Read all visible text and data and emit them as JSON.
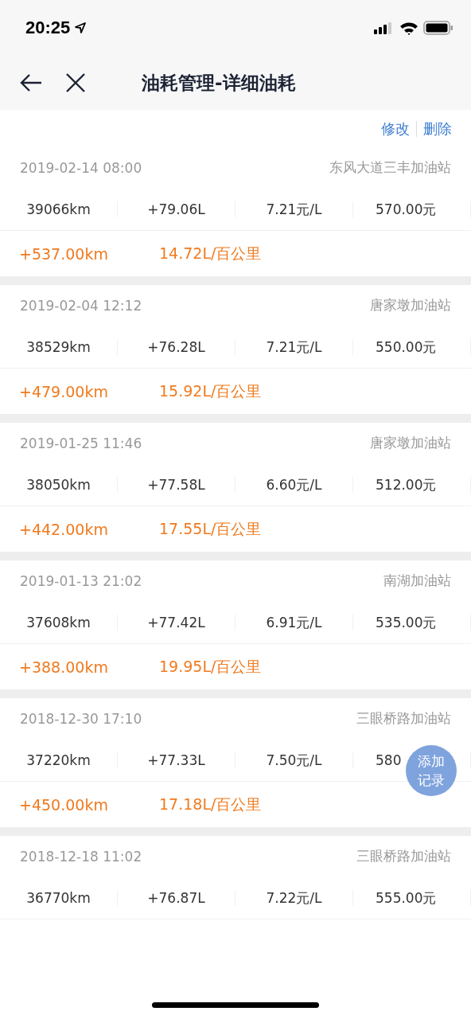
{
  "status_bar": {
    "time": "20:25"
  },
  "nav": {
    "title": "油耗管理-详细油耗"
  },
  "actions": [
    "修改",
    "删除"
  ],
  "records": [
    {
      "datetime": "2019-02-14 08:00",
      "station": "东风大道三丰加油站",
      "odometer": "39066km",
      "fuel": "+79.06L",
      "price": "7.21元/L",
      "amount": "570.00元",
      "distance": "+537.00km",
      "consumption": "14.72L/百公里"
    },
    {
      "datetime": "2019-02-04 12:12",
      "station": "唐家墩加油站",
      "odometer": "38529km",
      "fuel": "+76.28L",
      "price": "7.21元/L",
      "amount": "550.00元",
      "distance": "+479.00km",
      "consumption": "15.92L/百公里"
    },
    {
      "datetime": "2019-01-25 11:46",
      "station": "唐家墩加油站",
      "odometer": "38050km",
      "fuel": "+77.58L",
      "price": "6.60元/L",
      "amount": "512.00元",
      "distance": "+442.00km",
      "consumption": "17.55L/百公里"
    },
    {
      "datetime": "2019-01-13 21:02",
      "station": "南湖加油站",
      "odometer": "37608km",
      "fuel": "+77.42L",
      "price": "6.91元/L",
      "amount": "535.00元",
      "distance": "+388.00km",
      "consumption": "19.95L/百公里"
    },
    {
      "datetime": "2018-12-30 17:10",
      "station": "三眼桥路加油站",
      "odometer": "37220km",
      "fuel": "+77.33L",
      "price": "7.50元/L",
      "amount": "580",
      "distance": "+450.00km",
      "consumption": "17.18L/百公里"
    },
    {
      "datetime": "2018-12-18 11:02",
      "station": "三眼桥路加油站",
      "odometer": "36770km",
      "fuel": "+76.87L",
      "price": "7.22元/L",
      "amount": "555.00元"
    }
  ],
  "fab": {
    "label_lines": [
      "添加",
      "记录"
    ]
  }
}
